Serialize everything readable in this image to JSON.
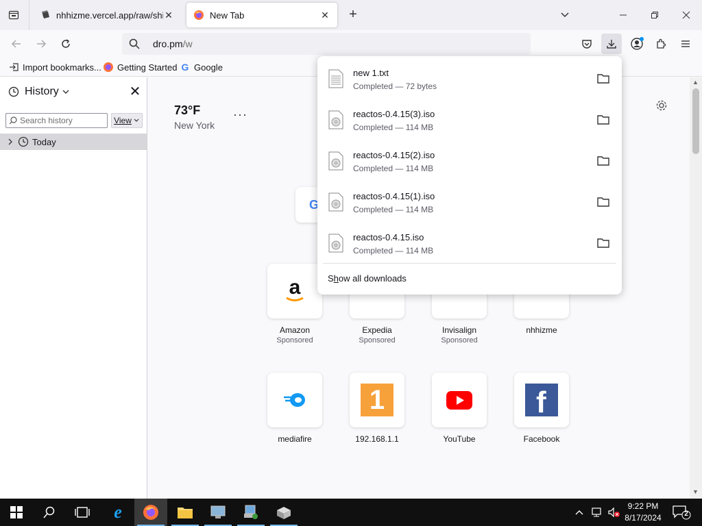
{
  "tabs": [
    {
      "title": "nhhizme.vercel.app/raw/shit.txt",
      "active": false
    },
    {
      "title": "New Tab",
      "active": true
    }
  ],
  "navbar": {
    "url_host": "dro.pm",
    "url_path": "/w"
  },
  "bookmarks": [
    "Import bookmarks...",
    "Getting Started",
    "Google"
  ],
  "sidebar": {
    "title": "History",
    "search_placeholder": "Search history",
    "view_label": "View",
    "today_label": "Today"
  },
  "weather": {
    "temp": "73°F",
    "city": "New York",
    "more": "···"
  },
  "tiles": [
    {
      "label": "Amazon",
      "sponsored": "Sponsored"
    },
    {
      "label": "Expedia",
      "sponsored": "Sponsored"
    },
    {
      "label": "Invisalign",
      "sponsored": "Sponsored"
    },
    {
      "label": "nhhizme",
      "sponsored": ""
    },
    {
      "label": "mediafire",
      "sponsored": ""
    },
    {
      "label": "192.168.1.1",
      "sponsored": ""
    },
    {
      "label": "YouTube",
      "sponsored": ""
    },
    {
      "label": "Facebook",
      "sponsored": ""
    }
  ],
  "downloads": {
    "items": [
      {
        "name": "new 1.txt",
        "status": "Completed — 72 bytes",
        "type": "text"
      },
      {
        "name": "reactos-0.4.15(3).iso",
        "status": "Completed — 114 MB",
        "type": "iso"
      },
      {
        "name": "reactos-0.4.15(2).iso",
        "status": "Completed — 114 MB",
        "type": "iso"
      },
      {
        "name": "reactos-0.4.15(1).iso",
        "status": "Completed — 114 MB",
        "type": "iso"
      },
      {
        "name": "reactos-0.4.15.iso",
        "status": "Completed — 114 MB",
        "type": "iso"
      }
    ],
    "show_all_pre": "S",
    "show_all_u": "h",
    "show_all_post": "ow all downloads"
  },
  "taskbar": {
    "time": "9:22 PM",
    "date": "8/17/2024",
    "notification_count": "2"
  },
  "colors": {
    "accent": "#0061e0",
    "taskbar": "#101010"
  }
}
